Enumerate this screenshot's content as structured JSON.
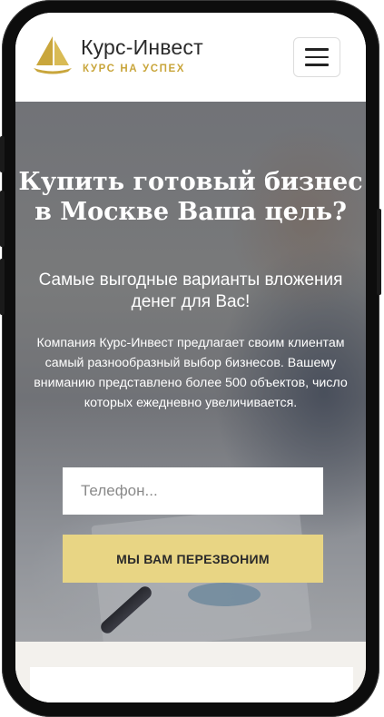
{
  "header": {
    "brand_name": "Курс-Инвест",
    "brand_tagline": "КУРС НА УСПЕХ",
    "menu_icon": "hamburger-menu-icon"
  },
  "hero": {
    "title": "Купить готовый бизнес в Москве Ваша цель?",
    "subtitle": "Самые выгодные варианты вложения денег для Вас!",
    "description": "Компания Курс-Инвест предлагает своим клиентам самый разнообразный выбор бизнесов. Вашему вниманию представлено более 500 объектов, число которых ежедневно увеличивается.",
    "phone_placeholder": "Телефон...",
    "callback_label": "МЫ ВАМ ПЕРЕЗВОНИМ"
  },
  "colors": {
    "accent_gold": "#c9a63c",
    "button_gold": "#e8d584",
    "text_dark": "#2b2b2b"
  }
}
